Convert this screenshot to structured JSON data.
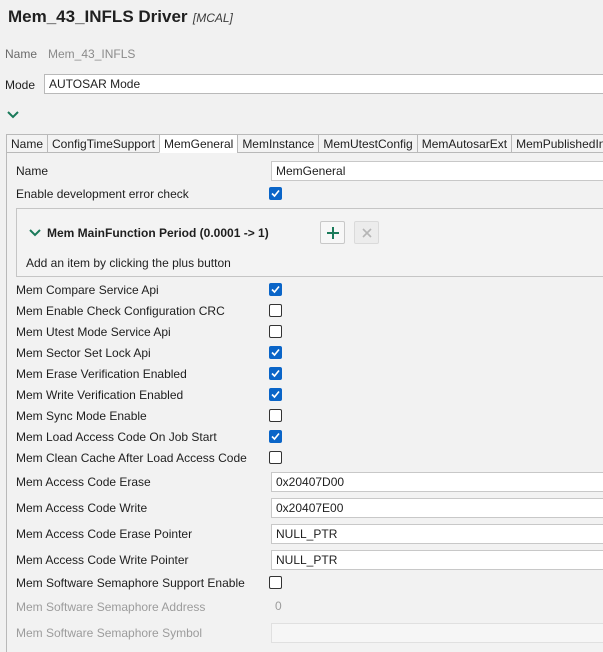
{
  "header": {
    "title": "Mem_43_INFLS Driver",
    "tag": "[MCAL]"
  },
  "top": {
    "name_label": "Name",
    "name_value": "Mem_43_INFLS",
    "mode_label": "Mode",
    "mode_value": "AUTOSAR Mode"
  },
  "tabs": [
    {
      "label": "Name"
    },
    {
      "label": "ConfigTimeSupport"
    },
    {
      "label": "MemGeneral"
    },
    {
      "label": "MemInstance"
    },
    {
      "label": "MemUtestConfig"
    },
    {
      "label": "MemAutosarExt"
    },
    {
      "label": "MemPublishedInf"
    }
  ],
  "active_tab": "MemGeneral",
  "general": {
    "name_label": "Name",
    "name_value": "MemGeneral",
    "dev_error_label": "Enable development error check",
    "dev_error_checked": true,
    "group": {
      "title": "Mem MainFunction Period (0.0001 -> 1)",
      "hint": "Add an item by clicking the plus button",
      "add_icon": "plus-icon",
      "remove_icon": "close-icon"
    },
    "checkboxes": [
      {
        "label": "Mem Compare Service Api",
        "checked": true
      },
      {
        "label": "Mem Enable Check Configuration CRC",
        "checked": false
      },
      {
        "label": "Mem Utest Mode Service Api",
        "checked": false
      },
      {
        "label": "Mem Sector Set Lock Api",
        "checked": true
      },
      {
        "label": "Mem Erase Verification Enabled",
        "checked": true
      },
      {
        "label": "Mem Write Verification Enabled",
        "checked": true
      },
      {
        "label": "Mem Sync Mode Enable",
        "checked": false
      },
      {
        "label": "Mem Load Access Code On Job Start",
        "checked": true
      },
      {
        "label": "Mem Clean Cache After Load Access Code",
        "checked": false
      }
    ],
    "fields": [
      {
        "label": "Mem Access Code Erase",
        "value": "0x20407D00"
      },
      {
        "label": "Mem Access Code Write",
        "value": "0x20407E00"
      },
      {
        "label": "Mem Access Code Erase Pointer",
        "value": "NULL_PTR"
      },
      {
        "label": "Mem Access Code Write Pointer",
        "value": "NULL_PTR"
      }
    ],
    "semaphore": {
      "support_label": "Mem Software Semaphore Support Enable",
      "support_checked": false,
      "address_label": "Mem Software Semaphore Address",
      "address_value": "0",
      "symbol_label": "Mem Software Semaphore Symbol",
      "symbol_value": ""
    }
  },
  "colors": {
    "accent": "#0a65c8",
    "add_icon": "#1a7a5a",
    "background": "#f1f1f1"
  }
}
